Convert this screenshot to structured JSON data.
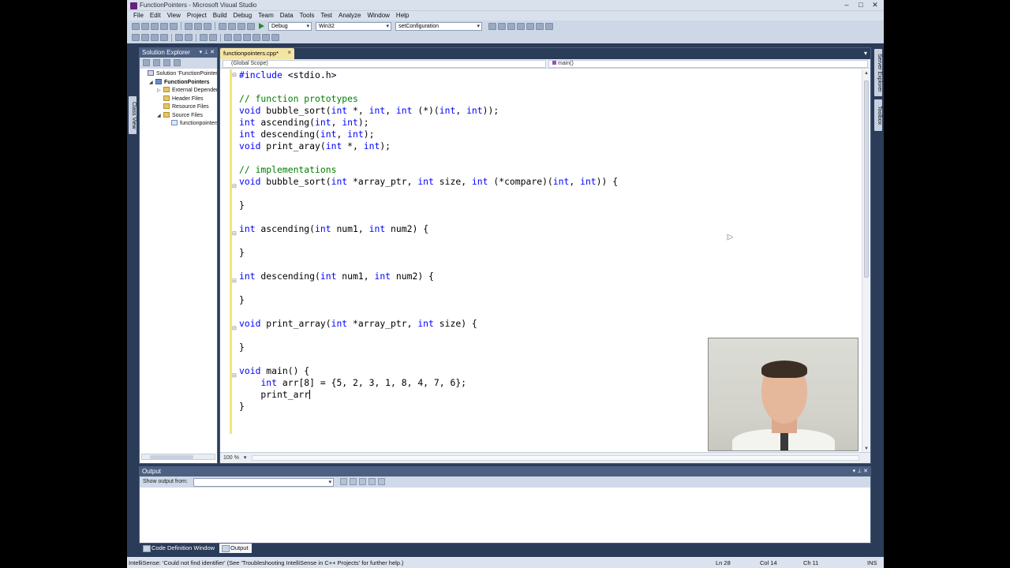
{
  "window": {
    "title": "FunctionPointers - Microsoft Visual Studio",
    "controls": [
      "–",
      "□",
      "✕"
    ]
  },
  "menu": [
    "File",
    "Edit",
    "View",
    "Project",
    "Build",
    "Debug",
    "Team",
    "Data",
    "Tools",
    "Test",
    "Analyze",
    "Window",
    "Help"
  ],
  "toolbar": {
    "configuration": "Debug",
    "platform": "Win32",
    "find_combo": "setConfiguration"
  },
  "solution_explorer": {
    "title": "Solution Explorer",
    "side_tab": "Class View",
    "items": [
      {
        "label": "Solution 'FunctionPointers'",
        "indent": 0,
        "expander": "",
        "icon": "sln"
      },
      {
        "label": "FunctionPointers",
        "indent": 1,
        "expander": "◢",
        "icon": "proj"
      },
      {
        "label": "External Dependencies",
        "indent": 2,
        "expander": "▷",
        "icon": "folder"
      },
      {
        "label": "Header Files",
        "indent": 2,
        "expander": "",
        "icon": "folder"
      },
      {
        "label": "Resource Files",
        "indent": 2,
        "expander": "",
        "icon": "folder"
      },
      {
        "label": "Source Files",
        "indent": 2,
        "expander": "◢",
        "icon": "folder"
      },
      {
        "label": "functionpointers.cpp",
        "indent": 3,
        "expander": "",
        "icon": "file"
      }
    ]
  },
  "editor": {
    "tab": "functionpointers.cpp*",
    "scope": "(Global Scope)",
    "function": "main()",
    "zoom": "100 %",
    "code_lines": [
      "#include <stdio.h>",
      "",
      "// function prototypes",
      "void bubble_sort(int *, int, int (*)(int, int));",
      "int ascending(int, int);",
      "int descending(int, int);",
      "void print_aray(int *, int);",
      "",
      "// implementations",
      "void bubble_sort(int *array_ptr, int size, int (*compare)(int, int)) {",
      "",
      "}",
      "",
      "int ascending(int num1, int num2) {",
      "",
      "}",
      "",
      "int descending(int num1, int num2) {",
      "",
      "}",
      "",
      "void print_array(int *array_ptr, int size) {",
      "",
      "}",
      "",
      "void main() {",
      "    int arr[8] = {5, 2, 3, 1, 8, 4, 7, 6};",
      "    print_arr",
      "}"
    ]
  },
  "right_tabs": [
    "Server Explorer",
    "Toolbox"
  ],
  "output": {
    "title": "Output",
    "show_from_label": "Show output from:",
    "show_from_value": ""
  },
  "bottom_tabs": [
    "Code Definition Window",
    "Output"
  ],
  "status": {
    "message": "IntelliSense: 'Could not find identifier' (See 'Troubleshooting IntelliSense in C++ Projects' for further help.)",
    "line": "Ln 28",
    "col": "Col 14",
    "ch": "Ch 11",
    "mode": "INS"
  }
}
